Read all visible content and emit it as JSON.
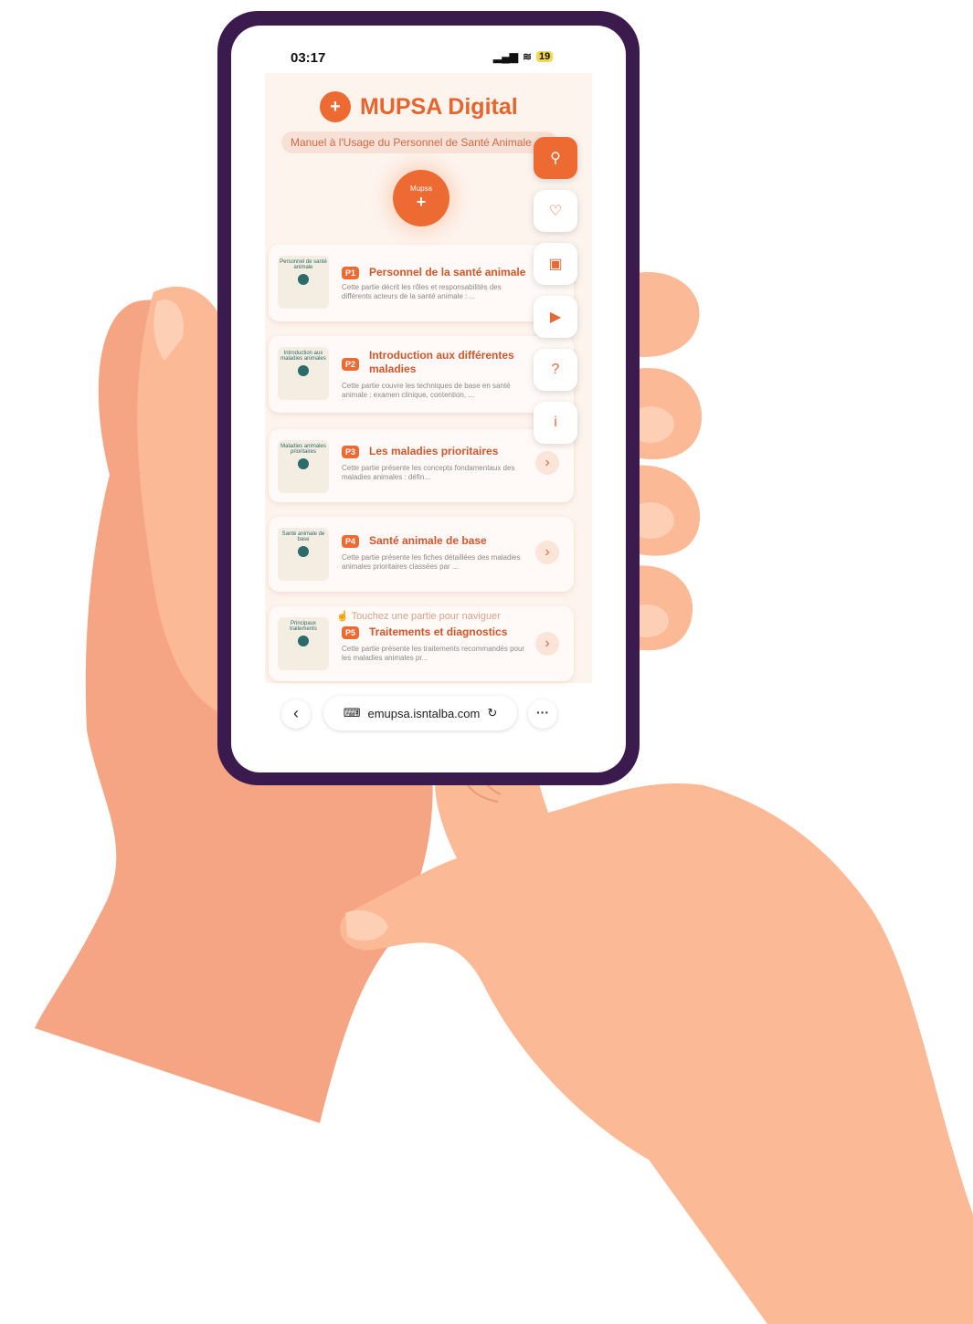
{
  "status": {
    "time": "03:17",
    "signal": "▂▄▆",
    "wifi": "≋",
    "battery": "19"
  },
  "header": {
    "logo": "+",
    "title": "MUPSA Digital",
    "subtitle": "Manuel à l'Usage du Personnel de Santé Animale"
  },
  "badge": {
    "label": "Mupsa",
    "icon": "+"
  },
  "parts": [
    {
      "tag": "P1",
      "title": "Personnel de la santé animale",
      "desc": "Cette partie décrit les rôles et responsabilités des différents acteurs de la santé animale : ...",
      "thumb": "Personnel de santé animale"
    },
    {
      "tag": "P2",
      "title": "Introduction aux différentes maladies",
      "desc": "Cette partie couvre les techniques de base en santé animale : examen clinique, contention, ...",
      "thumb": "Introduction aux maladies animales"
    },
    {
      "tag": "P3",
      "title": "Les maladies prioritaires",
      "desc": "Cette partie présente les concepts fondamentaux des maladies animales : défin...",
      "thumb": "Maladies animales prioritaires"
    },
    {
      "tag": "P4",
      "title": "Santé animale de base",
      "desc": "Cette partie présente les fiches détaillées des maladies animales prioritaires classées par ...",
      "thumb": "Santé animale de base"
    },
    {
      "tag": "P5",
      "title": "Traitements et diagnostics",
      "desc": "Cette partie présente les traitements recommandés pour les maladies animales pr...",
      "thumb": "Principaux traitements"
    }
  ],
  "chevron": "›",
  "hint": "Touchez une partie pour naviguer",
  "side_actions": [
    {
      "icon": "search-icon",
      "glyph": "⚲"
    },
    {
      "icon": "heart-icon",
      "glyph": "♡"
    },
    {
      "icon": "book-icon",
      "glyph": "▣"
    },
    {
      "icon": "play-icon",
      "glyph": "▶"
    },
    {
      "icon": "help-icon",
      "glyph": "?"
    },
    {
      "icon": "info-icon",
      "glyph": "i"
    }
  ],
  "browser": {
    "back": "‹",
    "url": "emupsa.isntalba.com",
    "reload": "↻",
    "more": "···"
  },
  "colors": {
    "accent": "#ee6a33",
    "phone_frame": "#3b1a4e",
    "skin": "#fbb995",
    "skin_shadow": "#f5a584"
  }
}
